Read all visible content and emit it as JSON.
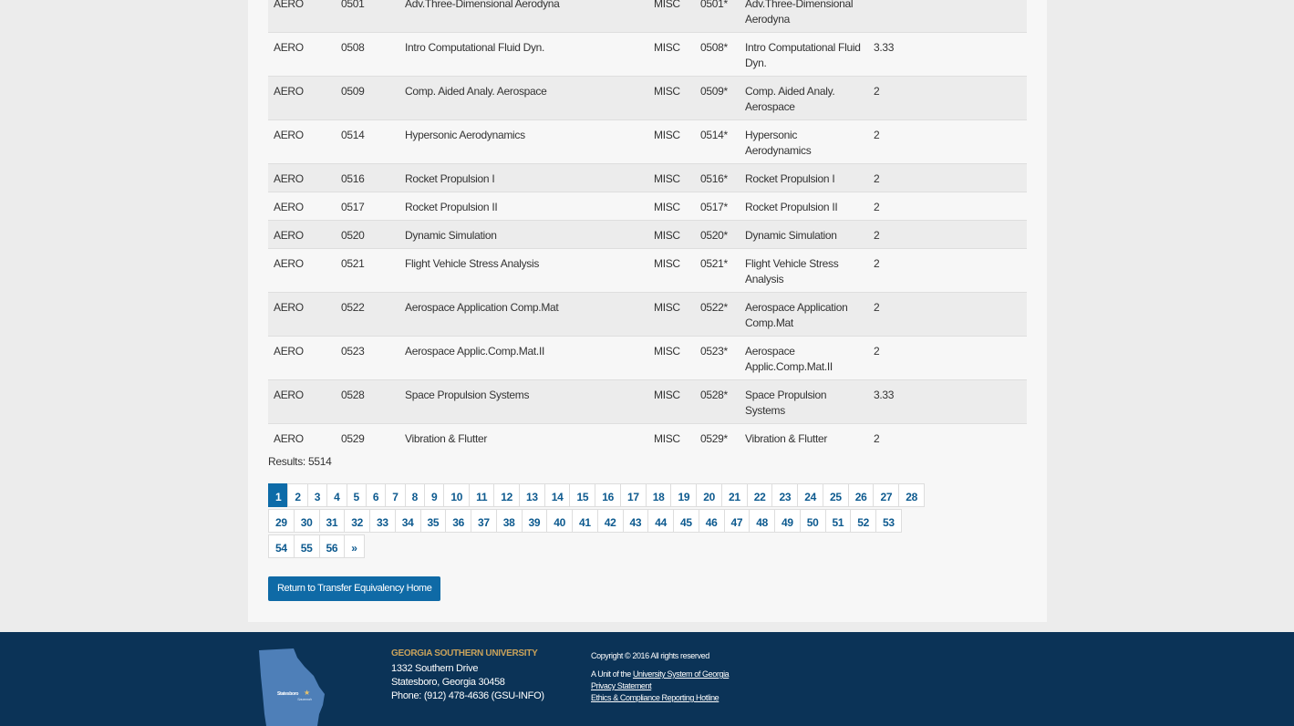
{
  "table": {
    "rows": [
      {
        "subj": "AERO",
        "num": "0501",
        "title": "Adv.Three-Dimensional Aerodyna",
        "eq_subj": "MISC",
        "eq_num": "0501*",
        "eq_title": "Adv.Three-Dimensional Aerodyna",
        "credits": ""
      },
      {
        "subj": "AERO",
        "num": "0508",
        "title": "Intro Computational Fluid Dyn.",
        "eq_subj": "MISC",
        "eq_num": "0508*",
        "eq_title": "Intro Computational Fluid Dyn.",
        "credits": "3.33"
      },
      {
        "subj": "AERO",
        "num": "0509",
        "title": "Comp. Aided Analy. Aerospace",
        "eq_subj": "MISC",
        "eq_num": "0509*",
        "eq_title": "Comp. Aided Analy. Aerospace",
        "credits": "2"
      },
      {
        "subj": "AERO",
        "num": "0514",
        "title": "Hypersonic Aerodynamics",
        "eq_subj": "MISC",
        "eq_num": "0514*",
        "eq_title": "Hypersonic Aerodynamics",
        "credits": "2"
      },
      {
        "subj": "AERO",
        "num": "0516",
        "title": "Rocket Propulsion I",
        "eq_subj": "MISC",
        "eq_num": "0516*",
        "eq_title": "Rocket Propulsion I",
        "credits": "2"
      },
      {
        "subj": "AERO",
        "num": "0517",
        "title": "Rocket Propulsion II",
        "eq_subj": "MISC",
        "eq_num": "0517*",
        "eq_title": "Rocket Propulsion II",
        "credits": "2"
      },
      {
        "subj": "AERO",
        "num": "0520",
        "title": "Dynamic Simulation",
        "eq_subj": "MISC",
        "eq_num": "0520*",
        "eq_title": "Dynamic Simulation",
        "credits": "2"
      },
      {
        "subj": "AERO",
        "num": "0521",
        "title": "Flight Vehicle Stress Analysis",
        "eq_subj": "MISC",
        "eq_num": "0521*",
        "eq_title": "Flight Vehicle Stress Analysis",
        "credits": "2"
      },
      {
        "subj": "AERO",
        "num": "0522",
        "title": "Aerospace Application Comp.Mat",
        "eq_subj": "MISC",
        "eq_num": "0522*",
        "eq_title": "Aerospace Application Comp.Mat",
        "credits": "2"
      },
      {
        "subj": "AERO",
        "num": "0523",
        "title": "Aerospace Applic.Comp.Mat.II",
        "eq_subj": "MISC",
        "eq_num": "0523*",
        "eq_title": "Aerospace Applic.Comp.Mat.II",
        "credits": "2"
      },
      {
        "subj": "AERO",
        "num": "0528",
        "title": "Space Propulsion Systems",
        "eq_subj": "MISC",
        "eq_num": "0528*",
        "eq_title": "Space Propulsion Systems",
        "credits": "3.33"
      },
      {
        "subj": "AERO",
        "num": "0529",
        "title": "Vibration & Flutter",
        "eq_subj": "MISC",
        "eq_num": "0529*",
        "eq_title": "Vibration & Flutter",
        "credits": "2"
      }
    ]
  },
  "results_text": "Results: 5514",
  "pagination": {
    "rows": [
      [
        "1",
        "2",
        "3",
        "4",
        "5",
        "6",
        "7",
        "8",
        "9",
        "10",
        "11",
        "12",
        "13",
        "14",
        "15",
        "16",
        "17",
        "18",
        "19",
        "20",
        "21",
        "22",
        "23",
        "24",
        "25",
        "26",
        "27",
        "28"
      ],
      [
        "29",
        "30",
        "31",
        "32",
        "33",
        "34",
        "35",
        "36",
        "37",
        "38",
        "39",
        "40",
        "41",
        "42",
        "43",
        "44",
        "45",
        "46",
        "47",
        "48",
        "49",
        "50",
        "51",
        "52",
        "53"
      ],
      [
        "54",
        "55",
        "56",
        "»"
      ]
    ],
    "current": "1"
  },
  "return_button": "Return to Transfer Equivalency Home",
  "footer": {
    "map_label_city": "Statesboro",
    "map_label_city2": "Savannah",
    "university": "GEORGIA SOUTHERN UNIVERSITY",
    "address_line1": "1332 Southern Drive",
    "address_line2": "Statesboro, Georgia 30458",
    "phone": "Phone: (912) 478-4636 (GSU-INFO)",
    "copyright": "Copyright © 2016 All rights reserved",
    "unit_prefix": "A Unit of the ",
    "unit_link": "University System of Georgia",
    "privacy": "Privacy Statement",
    "ethics": "Ethics & Compliance Reporting Hotline"
  },
  "colors": {
    "link": "#0d5a8f",
    "active_page": "#0d6ba8",
    "footer_bg": "#0b3357",
    "university_gold": "#c9a25b"
  }
}
